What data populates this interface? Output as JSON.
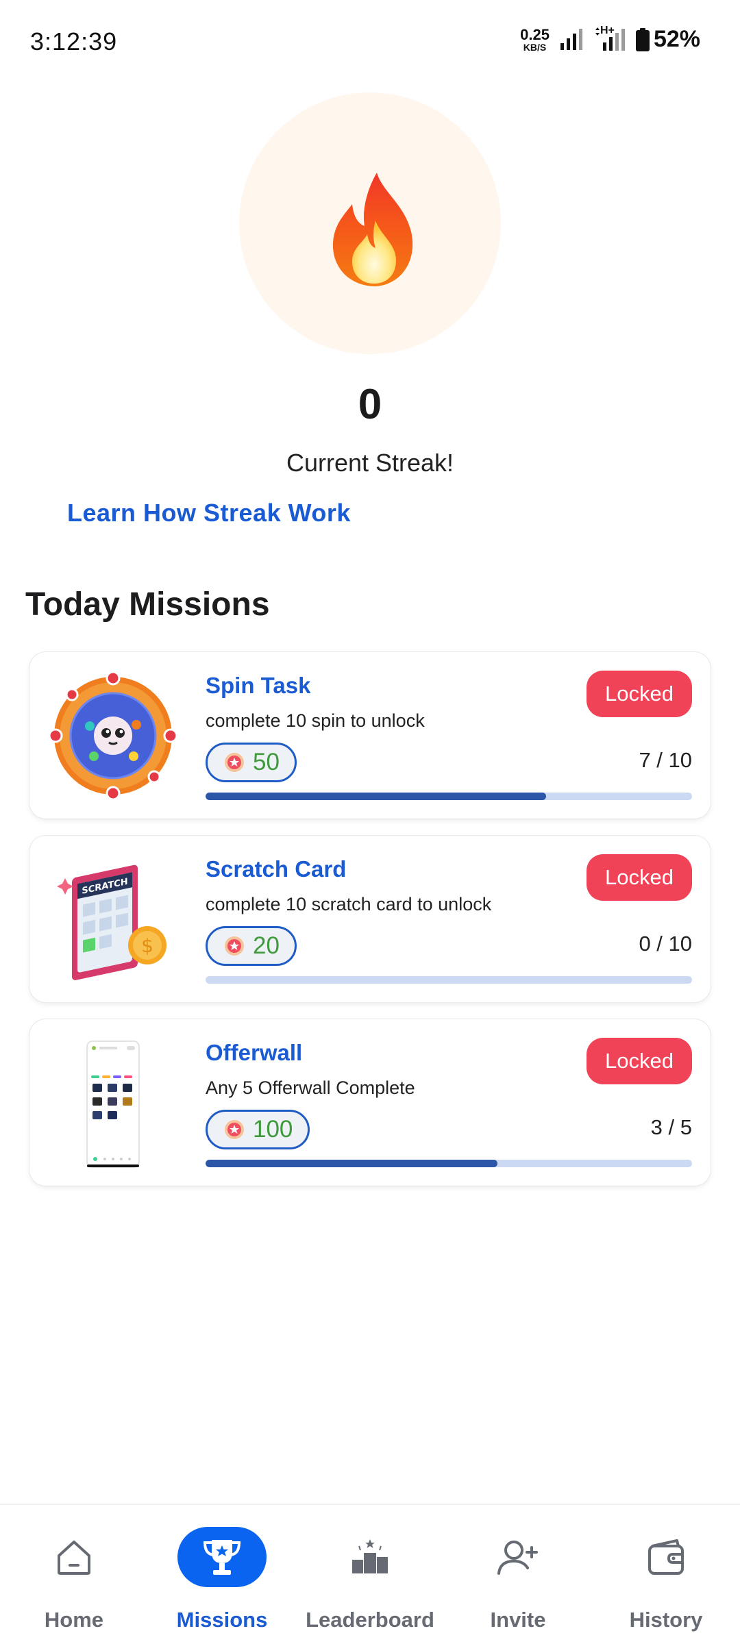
{
  "status_bar": {
    "time": "3:12:39",
    "net_speed_value": "0.25",
    "net_speed_unit": "KB/S",
    "network_type": "H+",
    "battery_percent": "52%"
  },
  "streak": {
    "count": "0",
    "label": "Current Streak!",
    "learn_link": "Learn How Streak Work"
  },
  "section_title": "Today Missions",
  "missions": [
    {
      "title": "Spin Task",
      "description": "complete 10 spin to unlock",
      "status": "Locked",
      "reward": "50",
      "progress_text": "7 / 10",
      "progress": 0.7
    },
    {
      "title": "Scratch Card",
      "description": "complete 10 scratch card to unlock",
      "status": "Locked",
      "reward": "20",
      "progress_text": "0 / 10",
      "progress": 0.0
    },
    {
      "title": "Offerwall",
      "description": "Any 5 Offerwall Complete",
      "status": "Locked",
      "reward": "100",
      "progress_text": "3 / 5",
      "progress": 0.6
    }
  ],
  "nav": [
    {
      "label": "Home",
      "icon": "home-icon",
      "active": false
    },
    {
      "label": "Missions",
      "icon": "trophy-icon",
      "active": true
    },
    {
      "label": "Leaderboard",
      "icon": "podium-icon",
      "active": false
    },
    {
      "label": "Invite",
      "icon": "add-user-icon",
      "active": false
    },
    {
      "label": "History",
      "icon": "wallet-icon",
      "active": false
    }
  ],
  "colors": {
    "accent_blue": "#1a5bd3",
    "locked_red": "#f04357",
    "reward_green": "#3e9a3b",
    "progress_fill": "#2e56a8",
    "progress_track": "#ccd9f3"
  }
}
